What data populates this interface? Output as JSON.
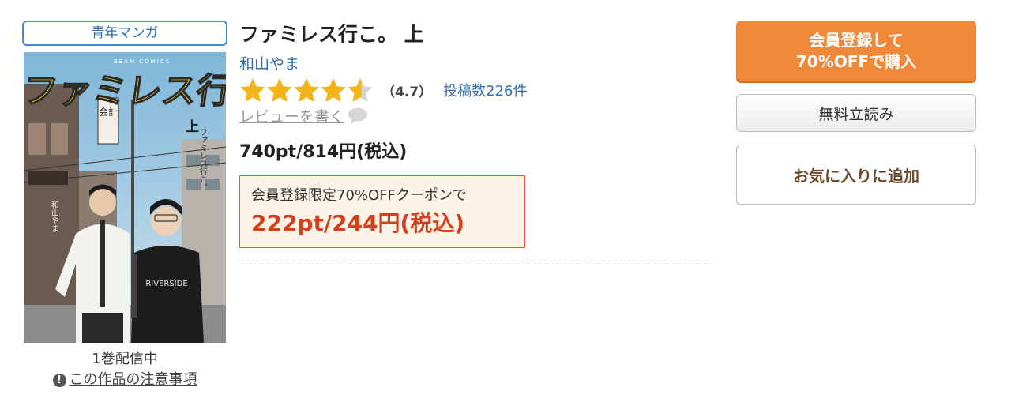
{
  "product": {
    "genre": "青年マンガ",
    "title": "ファミレス行こ。 上",
    "author": "和山やま",
    "rating": {
      "stars_filled": 4.7,
      "stars_total": 5,
      "score_text": "（4.7）",
      "review_count_text": "投稿数226件"
    },
    "review_write_label": "レビューを書く",
    "price_text": "740pt/814円(税込)",
    "coupon": {
      "label": "会員登録限定70%OFFクーポンで",
      "price_text": "222pt/244円(税込)"
    },
    "volume_status": "1巻配信中",
    "notice_label": "この作品の注意事項",
    "cover": {
      "title_art": "ファミレス行こ。",
      "label_art": "BEAM COMICS",
      "volume_art": "上",
      "author_art": "和山やま",
      "shirt_text": "RIVERSIDE",
      "sign_text": "会計"
    }
  },
  "actions": {
    "buy_line1": "会員登録して",
    "buy_line2": "70%OFFで購入",
    "free_read": "無料立読み",
    "favorite": "お気に入りに追加"
  },
  "colors": {
    "accent_orange": "#f0883a",
    "link_blue": "#2f6fb0",
    "star_gold": "#f2b418",
    "coupon_red": "#d43f1c",
    "coupon_bg": "#fdf3e6"
  },
  "icons": {
    "notice": "exclamation-circle-icon",
    "review": "speech-bubble-icon",
    "star": "star-icon"
  }
}
